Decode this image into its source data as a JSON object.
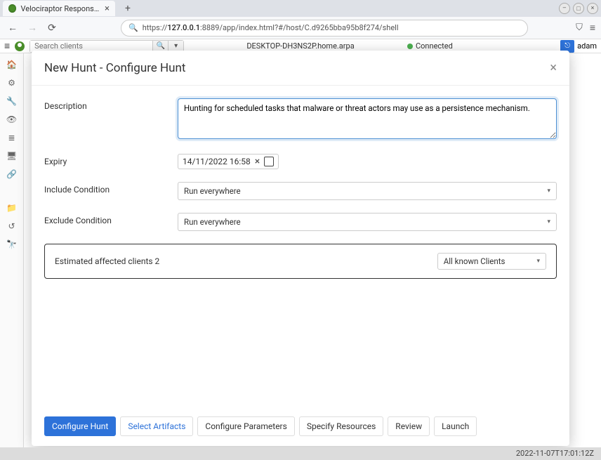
{
  "browser": {
    "tab_title": "Velociraptor Response a",
    "url_prefix": "https://",
    "url_host": "127.0.0.1",
    "url_path": ":8889/app/index.html?#/host/C.d9265bba95b8f274/shell"
  },
  "topbar": {
    "search_placeholder": "Search clients",
    "host": "DESKTOP-DH3NS2P.home.arpa",
    "connected": "Connected",
    "user": "adam"
  },
  "modal": {
    "title": "New Hunt - Configure Hunt",
    "description_label": "Description",
    "description_value": "Hunting for scheduled tasks that malware or threat actors may use as a persistence mechanism.",
    "expiry_label": "Expiry",
    "expiry_value": "14/11/2022 16:58",
    "include_label": "Include Condition",
    "include_value": "Run everywhere",
    "exclude_label": "Exclude Condition",
    "exclude_value": "Run everywhere",
    "affected_label": "Estimated affected clients 2",
    "affected_select": "All known Clients"
  },
  "footer_tabs": {
    "configure": "Configure Hunt",
    "select_artifacts": "Select Artifacts",
    "configure_params": "Configure Parameters",
    "specify_resources": "Specify Resources",
    "review": "Review",
    "launch": "Launch"
  },
  "timestamp": "2022-11-07T17:01:12Z"
}
